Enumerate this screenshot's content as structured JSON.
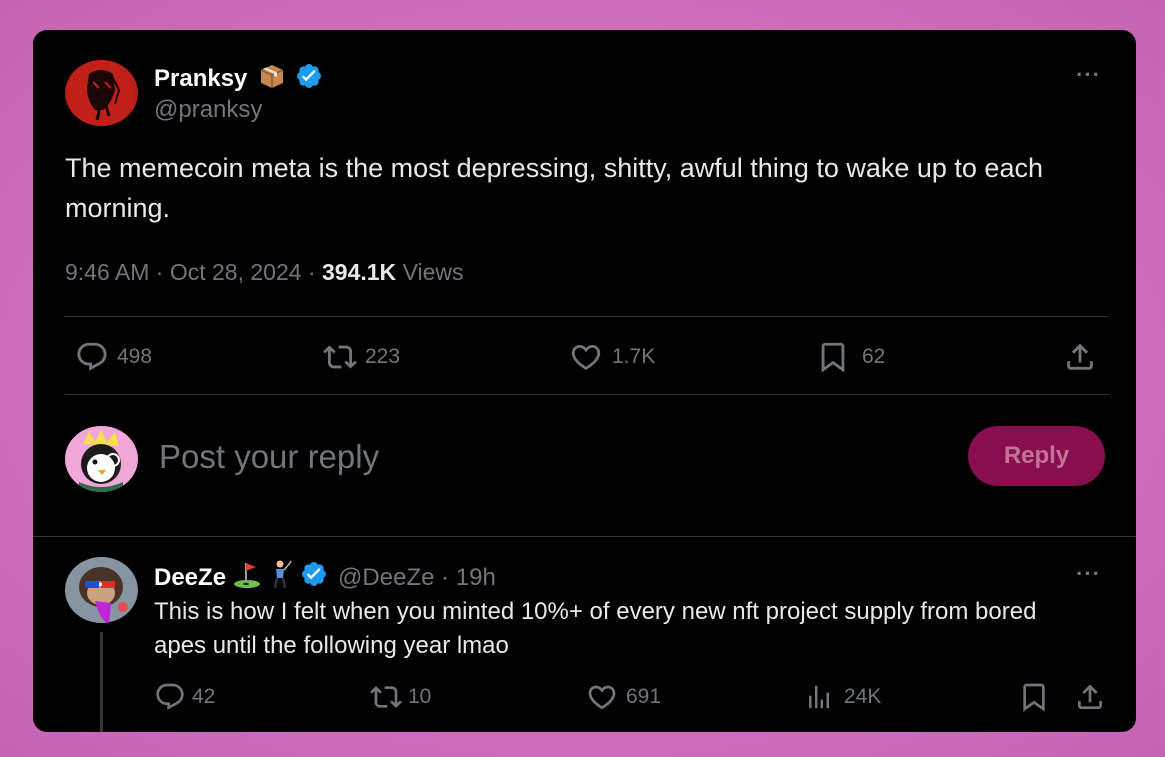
{
  "main_tweet": {
    "display_name": "Pranksy",
    "handle": "@pranksy",
    "text": "The memecoin meta is the most depressing, shitty, awful thing to wake up to each morning.",
    "time": "9:46 AM",
    "date": "Oct 28, 2024",
    "views_count": "394.1K",
    "views_label": "Views",
    "replies": "498",
    "reposts": "223",
    "likes": "1.7K",
    "bookmarks": "62"
  },
  "composer": {
    "placeholder": "Post your reply",
    "reply_button": "Reply"
  },
  "reply_tweet": {
    "display_name": "DeeZe",
    "handle": "@DeeZe",
    "age": "19h",
    "text": "This is how I felt when you minted 10%+ of every new nft project supply from bored apes until the following year lmao",
    "replies": "42",
    "reposts": "10",
    "likes": "691",
    "views": "24K"
  },
  "colors": {
    "background": "#cf6fbc",
    "card": "#000000",
    "verified": "#1d9bf0",
    "reply_button": "#880e4f",
    "muted": "#71767b"
  }
}
